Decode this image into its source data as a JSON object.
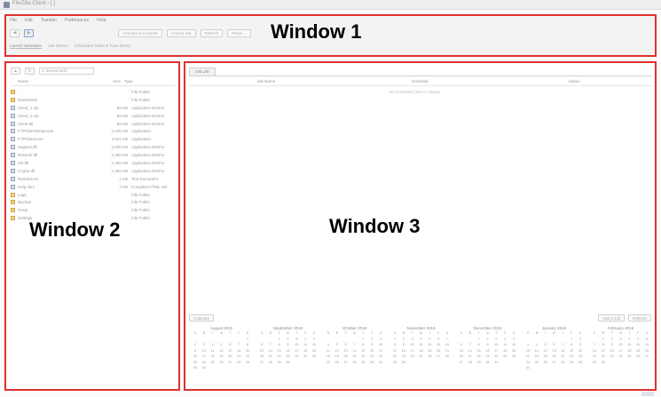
{
  "titlebar": {
    "title": "FileZilla Client - [ ]"
  },
  "window1": {
    "label": "Window 1",
    "menu": [
      "File",
      "Edit",
      "Transfer",
      "Preferences",
      "Help"
    ],
    "toolbar": [
      "Connect to a Server",
      "Cancel Job",
      "Refresh",
      "Parse ..."
    ],
    "subbar": [
      "Launch Scheduler",
      "Job Wizard",
      "Scheduled Tasks & Tools (Beta)"
    ]
  },
  "window2": {
    "label": "Window 2",
    "path": "C:\\Downloads\\",
    "headers": {
      "name": "Name",
      "size": "Size",
      "type": "Type"
    },
    "files": [
      {
        "name": "..",
        "size": "",
        "type": "File Folder",
        "kind": "folder"
      },
      {
        "name": "Downloads",
        "size": "",
        "type": "File Folder",
        "kind": "folder"
      },
      {
        "name": "Client_1.zip",
        "size": "95 KB",
        "type": "Application Extens",
        "kind": "file"
      },
      {
        "name": "Client_2.zip",
        "size": "85 KB",
        "type": "Application Extens",
        "kind": "file"
      },
      {
        "name": "Client.dll",
        "size": "55 KB",
        "type": "Application Extens",
        "kind": "file"
      },
      {
        "name": "FTPClientSetup.exe",
        "size": "2,105 KB",
        "type": "Application",
        "kind": "file"
      },
      {
        "name": "FTPClient.exe",
        "size": "4,021 KB",
        "type": "Application",
        "kind": "file"
      },
      {
        "name": "Support.dll",
        "size": "1,030 KB",
        "type": "Application Extens",
        "kind": "file"
      },
      {
        "name": "Network.dll",
        "size": "2,260 KB",
        "type": "Application Extens",
        "kind": "file"
      },
      {
        "name": "Ssl.dll",
        "size": "1,455 KB",
        "type": "Application Extens",
        "kind": "file"
      },
      {
        "name": "Crypto.dll",
        "size": "1,455 KB",
        "type": "Application Extens",
        "kind": "file"
      },
      {
        "name": "Readme.txt",
        "size": "1 KB",
        "type": "Text Document",
        "kind": "file"
      },
      {
        "name": "Help.chm",
        "size": "7 KB",
        "type": "Compiled HTML Hel",
        "kind": "file"
      },
      {
        "name": "Logs",
        "size": "",
        "type": "File Folder",
        "kind": "folder"
      },
      {
        "name": "Backup",
        "size": "",
        "type": "File Folder",
        "kind": "folder"
      },
      {
        "name": "Temp",
        "size": "",
        "type": "File Folder",
        "kind": "folder"
      },
      {
        "name": "Settings",
        "size": "",
        "type": "File Folder",
        "kind": "folder"
      }
    ]
  },
  "window3": {
    "label": "Window 3",
    "tab": "Job List",
    "columns": [
      "Job Name",
      "Schedule",
      "Status"
    ],
    "empty_text": "No scheduled jobs to display",
    "calendar_bar": {
      "left": "Calendar",
      "buttons": [
        "Add a Job",
        "Refresh"
      ]
    },
    "months": [
      "August 2015",
      "September 2015",
      "October 2015",
      "November 2015",
      "December 2015",
      "January 2016",
      "February 2016"
    ]
  },
  "colors": {
    "outline": "#e03030",
    "window_bg": "#ffffff",
    "folder": "#f1d37c"
  },
  "icons": [
    "back-arrow-icon",
    "forward-arrow-icon",
    "up-folder-icon",
    "file-icon",
    "folder-icon"
  ]
}
